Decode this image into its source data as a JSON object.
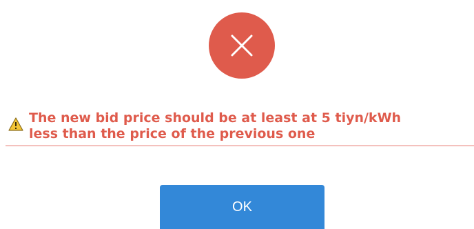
{
  "dialog": {
    "status_icon": "error-x-icon",
    "status_color": "#df5b4c",
    "message_icon": "warning-icon",
    "message_lines": [
      "The new bid price should be at least at 5 tiyn/kWh",
      "less than the price of the previous one"
    ],
    "message_color": "#df5b4c",
    "ok_label": "OK",
    "ok_color": "#3388d8"
  }
}
